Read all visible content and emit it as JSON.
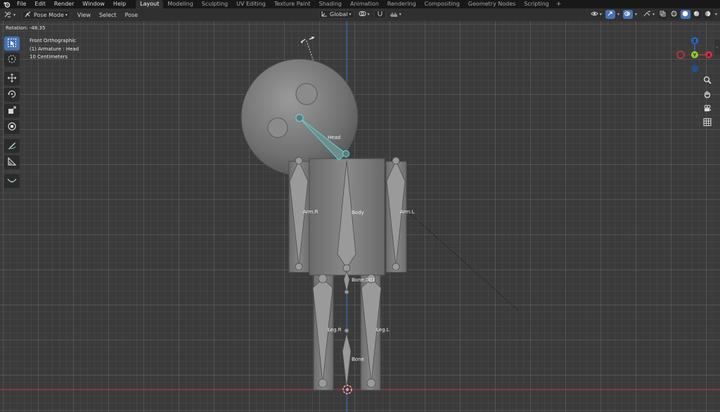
{
  "topbar": {
    "menus": [
      "File",
      "Edit",
      "Render",
      "Window",
      "Help"
    ],
    "workspaces": [
      "Layout",
      "Modeling",
      "Sculpting",
      "UV Editing",
      "Texture Paint",
      "Shading",
      "Animation",
      "Rendering",
      "Compositing",
      "Geometry Nodes",
      "Scripting"
    ],
    "active_workspace": "Layout",
    "add_workspace_label": "+"
  },
  "header": {
    "mode": "Pose Mode",
    "menus": [
      "View",
      "Select",
      "Pose"
    ],
    "orientation": "Global"
  },
  "status": {
    "rotation": "Rotation: -48.35"
  },
  "viewport_info": {
    "view": "Front Orthographic",
    "object": "(1) Armature : Head",
    "scale": "10 Centimeters"
  },
  "gizmo": {
    "z": "Z",
    "y": "Y",
    "x": "X"
  },
  "bones": {
    "head": "Head",
    "body": "Body",
    "arm_r": "Arm.R",
    "arm_l": "Arm.L",
    "bone_001": "Bone.001",
    "leg_r": "Leg.R",
    "leg_l": "Leg.L",
    "bone": "Bone"
  },
  "colors": {
    "accent": "#4772b3",
    "selected_bone": "#5fd1d0",
    "axis_x": "#cc3344",
    "axis_z": "#2f68b8",
    "axis_y": "#8fce2a"
  },
  "icons": {
    "toolbar": [
      "select-box-icon",
      "cursor-icon",
      "move-icon",
      "rotate-icon",
      "scale-icon",
      "transform-icon",
      "annotate-icon",
      "measure-icon",
      "relax-icon"
    ],
    "navigation": [
      "zoom-icon",
      "pan-hand-icon",
      "camera-icon",
      "grid-icon"
    ]
  }
}
